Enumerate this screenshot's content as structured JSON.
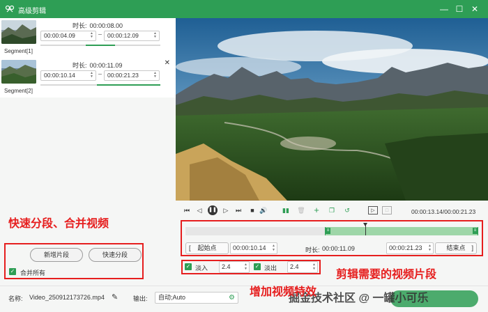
{
  "window": {
    "title": "高级剪辑",
    "minimize": "—",
    "maximize": "☐",
    "close": "✕"
  },
  "segments": [
    {
      "label": "Segment[1]",
      "duration_label": "时长:",
      "duration": "00:00:08.00",
      "start": "00:00:04.09",
      "end": "00:00:12.09",
      "progress_start": 0.38,
      "progress_end": 0.62
    },
    {
      "label": "Segment[2]",
      "duration_label": "时长:",
      "duration": "00:00:11.09",
      "start": "00:00:10.14",
      "end": "00:00:21.23",
      "progress_start": 0.47,
      "progress_end": 1.0
    }
  ],
  "left_actions": {
    "add_segment": "新增片段",
    "quick_split": "快速分段",
    "merge_all": "合并所有"
  },
  "annotations": {
    "split_merge": "快速分段、合并视频",
    "clip_needed": "剪辑需要的视频片段",
    "add_effects": "增加视频特效"
  },
  "player": {
    "time": "00:00:13.14/00:00:21.23",
    "playhead_fraction": 0.618
  },
  "range": {
    "start_label": "起始点",
    "start_value": "00:00:10.14",
    "duration_label": "时长:",
    "duration_value": "00:00:11.09",
    "end_value": "00:00:21.23",
    "end_label": "结束点"
  },
  "effects": {
    "fade_in_label": "淡入",
    "fade_in_value": "2.4",
    "fade_out_label": "淡出",
    "fade_out_value": "2.4"
  },
  "bottom": {
    "name_label": "名称:",
    "name_value": "Video_250912173726.mp4",
    "output_label": "输出:",
    "output_value": "自动;Auto"
  },
  "watermark": "掘金技术社区 @ 一罐小可乐",
  "colors": {
    "accent": "#2e9e55",
    "annotation": "#e61e1e"
  }
}
